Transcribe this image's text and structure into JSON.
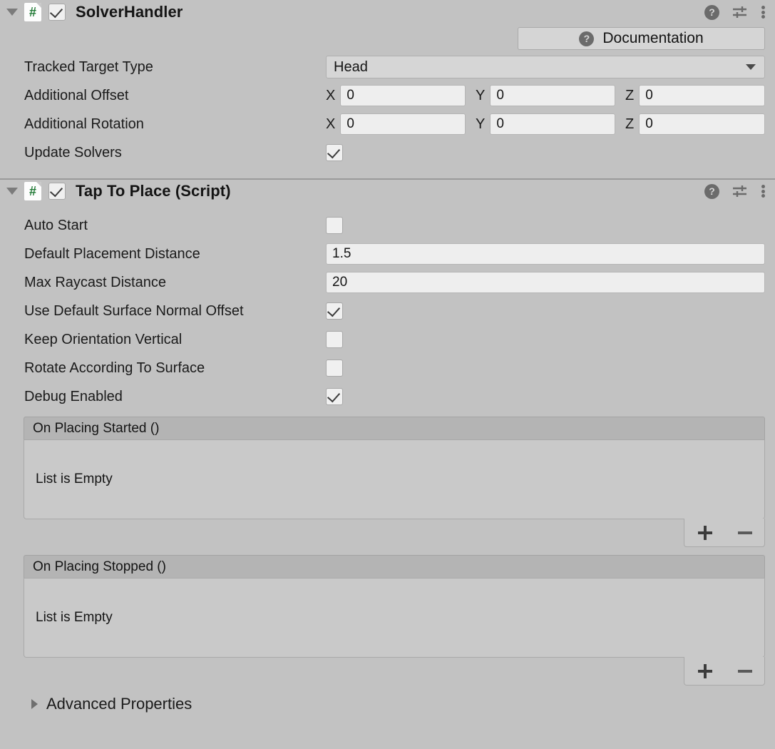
{
  "theme": {
    "background": "#c2c2c2",
    "field_bg": "#eeeeee",
    "dropdown_bg": "#d6d6d6",
    "event_header_bg": "#b4b4b4",
    "event_body_bg": "#c9c9c9",
    "script_icon_color": "#217a36",
    "text_color": "#141414"
  },
  "components": [
    {
      "title": "SolverHandler",
      "script_icon_glyph": "#",
      "enabled": true,
      "expanded": true,
      "header_icons": [
        "help-icon",
        "preset-icon",
        "more-menu-icon"
      ],
      "documentation": {
        "label": "Documentation",
        "icon": "help-icon"
      },
      "rows": [
        {
          "type": "dropdown",
          "label": "Tracked Target Type",
          "value": "Head"
        },
        {
          "type": "vector3",
          "label": "Additional Offset",
          "axes": [
            "X",
            "Y",
            "Z"
          ],
          "values": [
            "0",
            "0",
            "0"
          ]
        },
        {
          "type": "vector3",
          "label": "Additional Rotation",
          "axes": [
            "X",
            "Y",
            "Z"
          ],
          "values": [
            "0",
            "0",
            "0"
          ]
        },
        {
          "type": "checkbox",
          "label": "Update Solvers",
          "checked": true
        }
      ]
    },
    {
      "title": "Tap To Place (Script)",
      "script_icon_glyph": "#",
      "enabled": true,
      "expanded": true,
      "header_icons": [
        "help-icon",
        "preset-icon",
        "more-menu-icon"
      ],
      "rows": [
        {
          "type": "checkbox",
          "label": "Auto Start",
          "checked": false
        },
        {
          "type": "text",
          "label": "Default Placement Distance",
          "value": "1.5"
        },
        {
          "type": "text",
          "label": "Max Raycast Distance",
          "value": "20"
        },
        {
          "type": "checkbox",
          "label": "Use Default Surface Normal Offset",
          "checked": true
        },
        {
          "type": "checkbox",
          "label": "Keep Orientation Vertical",
          "checked": false
        },
        {
          "type": "checkbox",
          "label": "Rotate According To Surface",
          "checked": false
        },
        {
          "type": "checkbox",
          "label": "Debug Enabled",
          "checked": true
        }
      ],
      "events": [
        {
          "title": "On Placing Started ()",
          "empty_text": "List is Empty",
          "add_label": "+",
          "remove_label": "−"
        },
        {
          "title": "On Placing Stopped ()",
          "empty_text": "List is Empty",
          "add_label": "+",
          "remove_label": "−"
        }
      ],
      "advanced": {
        "label": "Advanced Properties",
        "expanded": false
      }
    }
  ]
}
